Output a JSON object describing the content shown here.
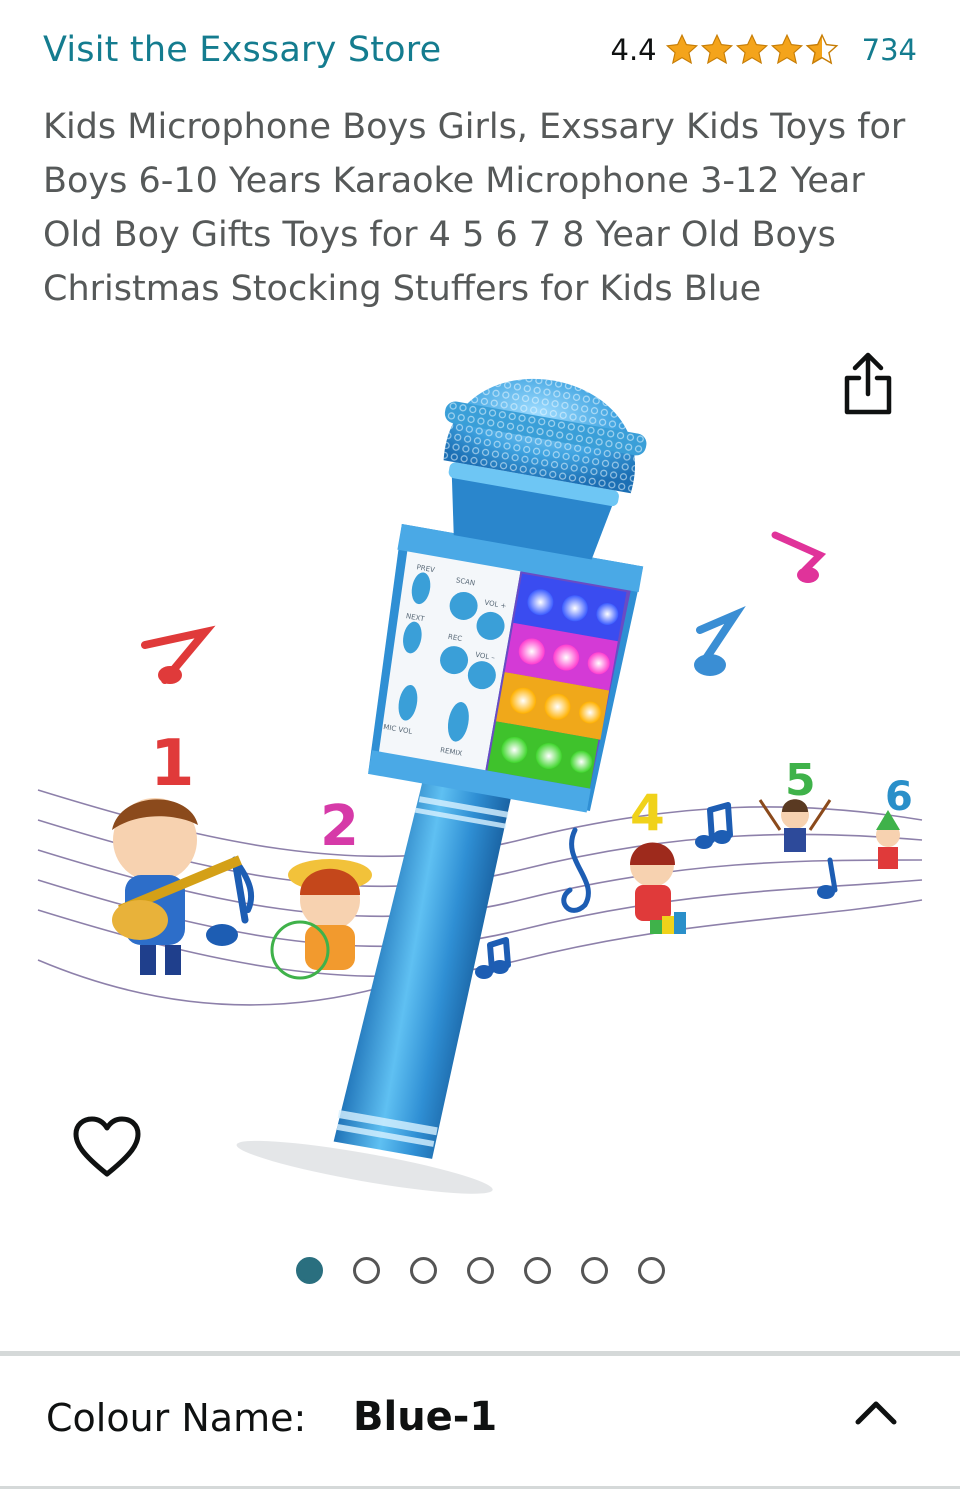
{
  "header": {
    "store_link": "Visit the Exssary Store",
    "rating_value": "4.4",
    "review_count": "734",
    "stars": {
      "full": 4,
      "partial": 0.5,
      "total": 5,
      "color": "#f4a41b"
    }
  },
  "product": {
    "title": "Kids Microphone Boys Girls, Exssary Kids Toys for Boys 6-10 Years Karaoke Microphone 3-12 Year Old Boy Gifts Toys for 4 5 6 7 8 Year Old Boys Christmas Stocking Stuffers for Kids Blue"
  },
  "image_panel": {
    "number_labels": [
      "1",
      "2",
      "4",
      "5",
      "6"
    ],
    "mic_button_labels": [
      "PREV",
      "SCAN",
      "VOL +",
      "NEXT",
      "REC",
      "VOL –",
      "MIC VOL",
      "REMIX"
    ],
    "share_icon": "share-icon",
    "wishlist_icon": "heart-icon",
    "carousel": {
      "count": 7,
      "active_index": 0
    }
  },
  "variant": {
    "label": "Colour Name:",
    "value": "Blue-1",
    "toggle_icon": "chevron-up-icon"
  },
  "colors": {
    "link": "#147c8f",
    "title_text": "#565959",
    "star": "#f4a41b",
    "active_dot": "#2a6f7f",
    "mic_blue": "#3a9fd8"
  }
}
